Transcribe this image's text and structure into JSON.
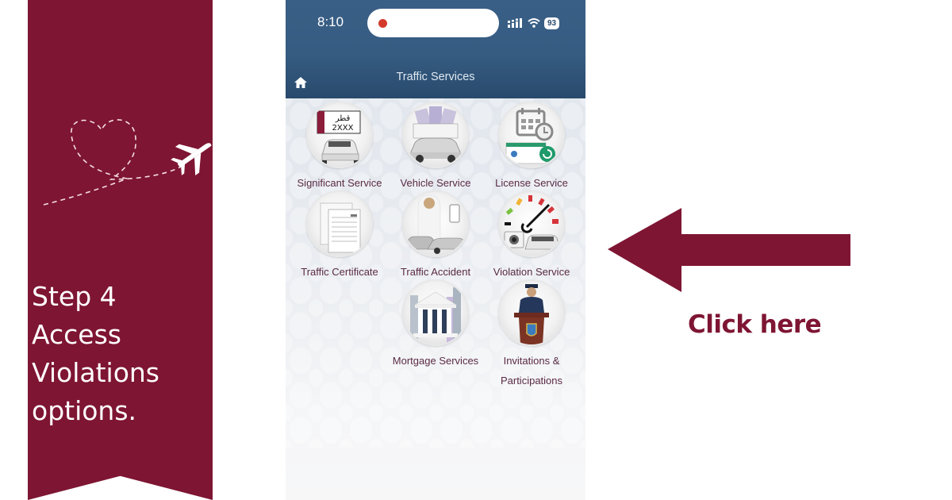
{
  "banner": {
    "background_color": "#7e1533",
    "decoration": "heart-and-airplane",
    "step_lines": [
      "Step 4",
      "Access",
      "Violations",
      "options."
    ]
  },
  "phone": {
    "status_bar": {
      "time": "8:10",
      "recording_indicator": "red-dot",
      "signal_icon": "cellular-signal-icon",
      "wifi_icon": "wifi-icon",
      "battery_level": "93"
    },
    "header": {
      "title": "Traffic Services",
      "home_icon": "home-icon",
      "color": "#365c82"
    },
    "services": [
      {
        "label": "Significant Service",
        "icon": "license-plate-car-icon",
        "plate_arabic": "قطر",
        "plate_number": "2XXX"
      },
      {
        "label": "Vehicle Service",
        "icon": "vehicle-documents-icon"
      },
      {
        "label": "License Service",
        "icon": "license-calendar-icon"
      },
      {
        "label": "Traffic Certificate",
        "icon": "certificate-documents-icon"
      },
      {
        "label": "Traffic Accident",
        "icon": "accident-cars-icon"
      },
      {
        "label": "Violation Service",
        "icon": "speedometer-camera-icon"
      },
      {
        "label": "Mortgage Services",
        "icon": "bank-building-icon"
      },
      {
        "label_lines": [
          "Invitations &",
          "Participations"
        ],
        "icon": "officer-podium-icon"
      }
    ]
  },
  "callout": {
    "arrow_direction": "left",
    "text": "Click here",
    "color": "#7e1533"
  }
}
